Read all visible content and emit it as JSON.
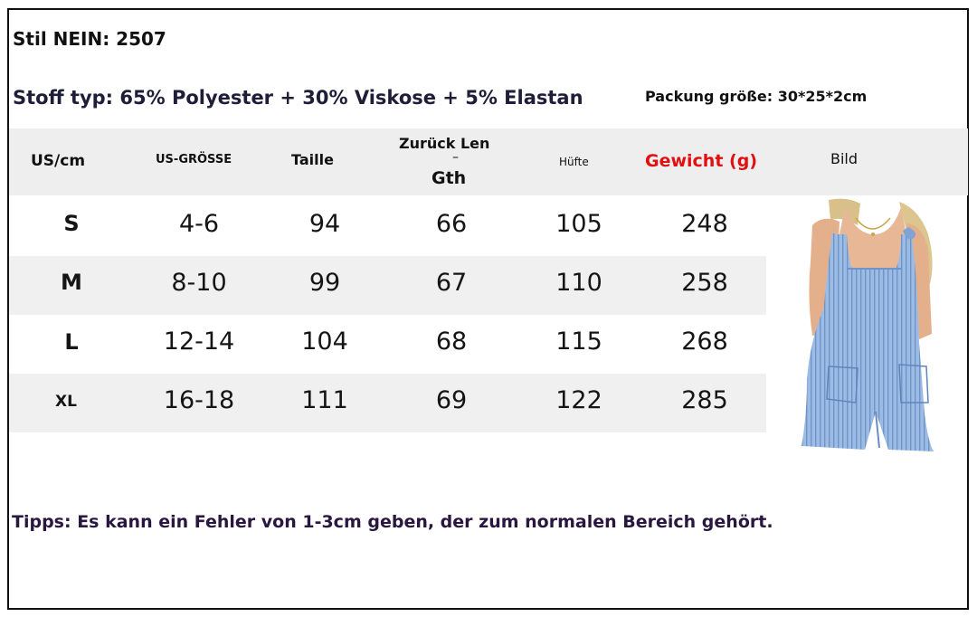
{
  "style_no": "Stil NEIN: 2507",
  "fabric": "Stoff typ: 65% Polyester + 30% Viskose + 5% Elastan",
  "package_size": "Packung größe: 30*25*2cm",
  "headers": {
    "us_cm": "US/cm",
    "us_size": "US-GRÖSSE",
    "waist": "Taille",
    "back_length_1": "Zurück Len",
    "back_length_dash": "–",
    "back_length_2": "Gth",
    "hip": "Hüfte",
    "weight": "Gewicht (g)",
    "picture": "Bild"
  },
  "rows": [
    {
      "size": "S",
      "us": "4-6",
      "waist": "94",
      "back": "66",
      "hip": "105",
      "weight": "248"
    },
    {
      "size": "M",
      "us": "8-10",
      "waist": "99",
      "back": "67",
      "hip": "110",
      "weight": "258"
    },
    {
      "size": "L",
      "us": "12-14",
      "waist": "104",
      "back": "68",
      "hip": "115",
      "weight": "268"
    },
    {
      "size": "XL",
      "us": "16-18",
      "waist": "111",
      "back": "69",
      "hip": "122",
      "weight": "285"
    }
  ],
  "tips": "Tipps: Es kann ein Fehler von 1-3cm geben, der zum normalen Bereich gehört.",
  "colors": {
    "weight_header": "#e01010",
    "romper": "#8fb3df",
    "tips_text": "#2a1740"
  }
}
